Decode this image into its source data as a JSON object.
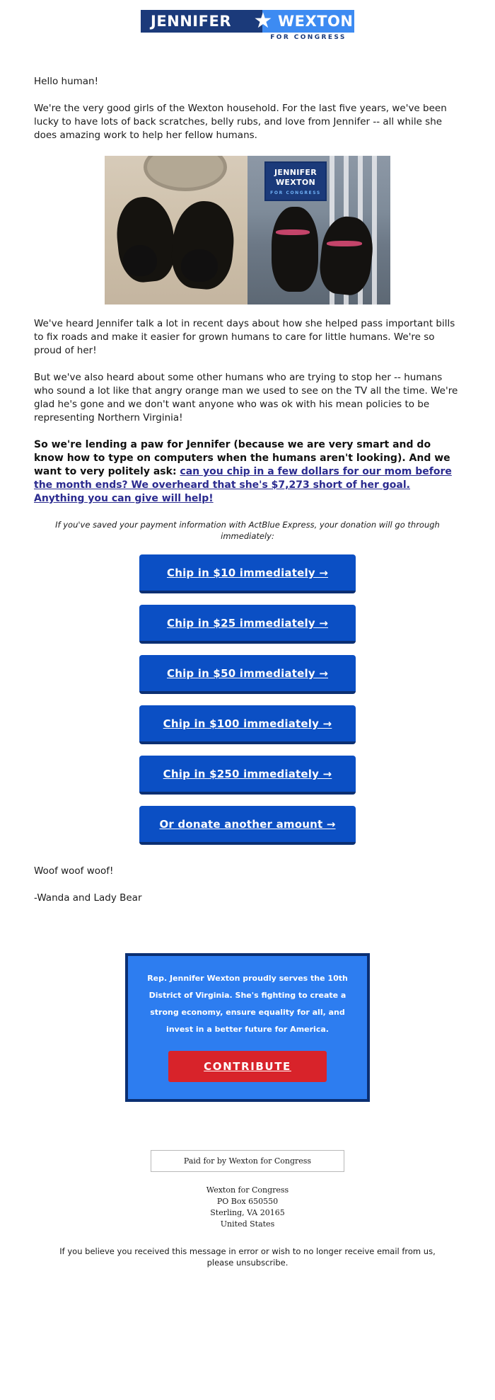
{
  "header": {
    "logo_first": "JENNIFER",
    "logo_last": "WEXTON",
    "logo_tagline": "FOR CONGRESS",
    "star_glyph": "★"
  },
  "body": {
    "greeting": "Hello human!",
    "para1": "We're the very good girls of the Wexton household. For the last five years, we've been lucky to have lots of back scratches, belly rubs, and love from Jennifer -- all while she does amazing work to help her fellow humans.",
    "para2": "We've heard Jennifer talk a lot in recent days about how she helped pass important bills to fix roads and make it easier for grown humans to care for little humans. We're so proud of her!",
    "para3": "But we've also heard about some other humans who are trying to stop her -- humans who sound a lot like that angry orange man we used to see on the TV all the time. We're glad he's gone and we don't want anyone who was ok with his mean policies to be representing Northern Virginia!",
    "para4_bold": "So we're lending a paw for Jennifer (because we are very smart and do know how to type on computers when the humans aren't looking). And we want to very politely ask: ",
    "para4_link": "can you chip in a few dollars for our mom before the month ends? We overheard that she's $7,273 short of her goal. Anything you can give will help!",
    "actblue_note": "If you've saved your payment information with ActBlue Express, your donation will go through immediately:",
    "signoff1": "Woof woof woof!",
    "signoff2": "-Wanda and Lady Bear"
  },
  "photos": {
    "left_alt": "two black labrador dogs lying on tile floor",
    "right_alt": "two black labrador dogs on a porch beside a Jennifer Wexton yard sign",
    "sign_line1": "JENNIFER",
    "sign_line2": "WEXTON",
    "sign_line3": "FOR CONGRESS"
  },
  "donation_buttons": [
    {
      "label": "Chip in $10 immediately  →"
    },
    {
      "label": "Chip in $25 immediately  →"
    },
    {
      "label": "Chip in $50 immediately  →"
    },
    {
      "label": "Chip in $100 immediately  →"
    },
    {
      "label": "Chip in $250 immediately  →"
    },
    {
      "label": "Or donate another amount  →"
    }
  ],
  "cta": {
    "text": "Rep. Jennifer Wexton proudly serves the 10th District of Virginia. She's fighting to create a strong economy, ensure equality for all, and invest in a better future for America.",
    "button_label": "CONTRIBUTE"
  },
  "footer": {
    "paid_for": "Paid for by Wexton for Congress",
    "addr_line1": "Wexton for Congress",
    "addr_line2": "PO Box 650550",
    "addr_line3": "Sterling, VA 20165",
    "addr_line4": "United States",
    "unsub_text": "If you believe you received this message in error or wish to no longer receive email from us, please unsubscribe."
  },
  "colors": {
    "navy": "#1b3a7a",
    "light_blue": "#3d8bf2",
    "button_blue": "#0b4fc4",
    "button_shadow": "#0b2f72",
    "cta_blue": "#2d7df0",
    "contribute_red": "#d8232a",
    "link_purple": "#2b2b8f"
  }
}
